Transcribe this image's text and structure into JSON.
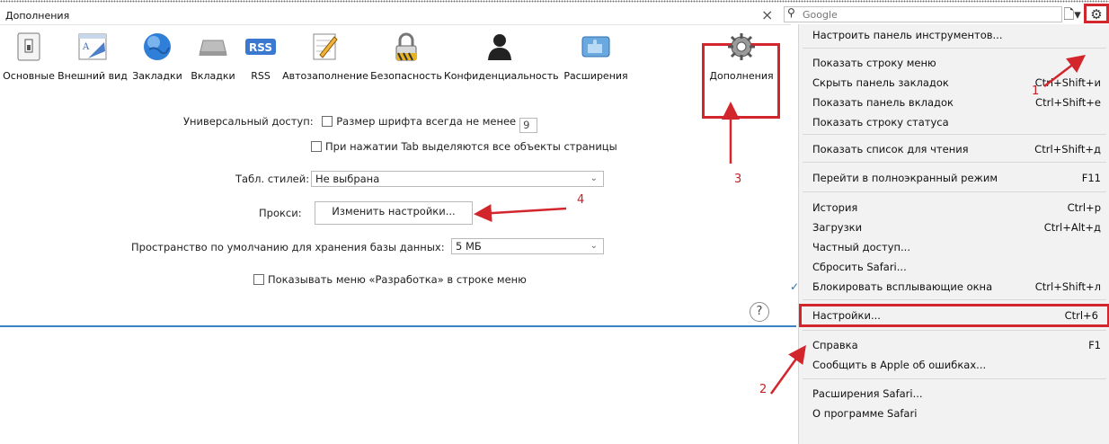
{
  "window": {
    "title": "Дополнения",
    "close_glyph": "×"
  },
  "toolbar": {
    "items": [
      {
        "label": "Основные",
        "icon": "general-switch-icon"
      },
      {
        "label": "Внешний вид",
        "icon": "appearance-icon"
      },
      {
        "label": "Закладки",
        "icon": "globe-icon"
      },
      {
        "label": "Вкладки",
        "icon": "tabs-icon"
      },
      {
        "label": "RSS",
        "icon": "rss-icon"
      },
      {
        "label": "Автозаполнение",
        "icon": "autofill-pencil-icon"
      },
      {
        "label": "Безопасность",
        "icon": "lock-icon"
      },
      {
        "label": "Конфиденциальность",
        "icon": "person-icon"
      },
      {
        "label": "Расширения",
        "icon": "puzzle-icon"
      },
      {
        "label": "Дополнения",
        "icon": "gears-icon",
        "selected": true
      }
    ],
    "rss_badge": "RSS"
  },
  "advanced": {
    "universal_access_label": "Универсальный доступ:",
    "min_font_label": "Размер шрифта всегда не менее",
    "min_font_value": "9",
    "tab_highlight_label": "При нажатии Tab выделяются все объекты страницы",
    "stylesheet_label": "Табл. стилей:",
    "stylesheet_value": "Не выбрана",
    "proxy_label": "Прокси:",
    "proxy_button": "Изменить настройки...",
    "db_storage_label": "Пространство по умолчанию для хранения базы данных:",
    "db_storage_value": "5 МБ",
    "develop_menu_label": "Показывать меню «Разработка» в строке меню",
    "help_glyph": "?"
  },
  "search": {
    "placeholder": "Google"
  },
  "menu": {
    "items": [
      {
        "label": "Настроить панель инструментов...",
        "key": ""
      },
      {
        "label": "Показать строку меню",
        "key": ""
      },
      {
        "label": "Скрыть панель закладок",
        "key": "Ctrl+Shift+и"
      },
      {
        "label": "Показать панель вкладок",
        "key": "Ctrl+Shift+е"
      },
      {
        "label": "Показать строку статуса",
        "key": ""
      },
      {
        "label": "Показать список для чтения",
        "key": "Ctrl+Shift+д"
      },
      {
        "label": "Перейти в полноэкранный режим",
        "key": "F11"
      },
      {
        "label": "История",
        "key": "Ctrl+р"
      },
      {
        "label": "Загрузки",
        "key": "Ctrl+Alt+д"
      },
      {
        "label": "Частный доступ...",
        "key": ""
      },
      {
        "label": "Сбросить Safari...",
        "key": ""
      },
      {
        "label": "Блокировать всплывающие окна",
        "key": "Ctrl+Shift+л",
        "checked": true
      },
      {
        "label": "Настройки...",
        "key": "Ctrl+6"
      },
      {
        "label": "Справка",
        "key": "F1"
      },
      {
        "label": "Сообщить в Apple об ошибках...",
        "key": ""
      },
      {
        "label": "Расширения Safari...",
        "key": ""
      },
      {
        "label": "О программе Safari",
        "key": ""
      }
    ]
  },
  "annotations": {
    "step1": "1",
    "step2": "2",
    "step3": "3",
    "step4": "4",
    "color": "#d3262c"
  }
}
